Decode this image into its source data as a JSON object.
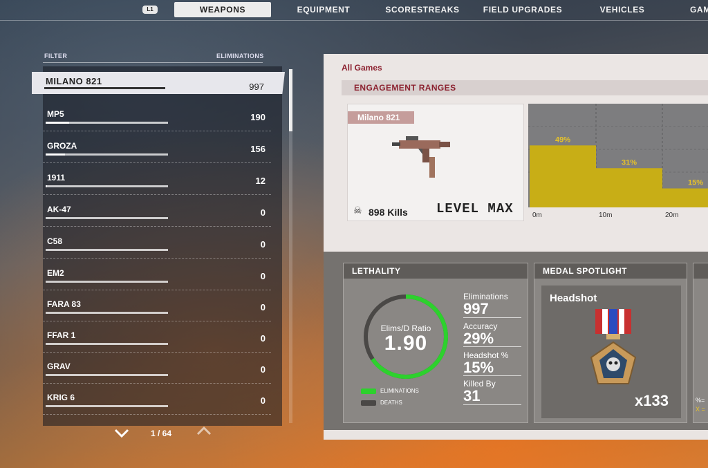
{
  "nav": {
    "l1_badge": "L1",
    "tabs": [
      {
        "label": "WEAPONS",
        "active": true
      },
      {
        "label": "EQUIPMENT",
        "active": false
      },
      {
        "label": "SCORESTREAKS",
        "active": false
      },
      {
        "label": "FIELD UPGRADES",
        "active": false
      },
      {
        "label": "VEHICLES",
        "active": false
      },
      {
        "label": "GAM",
        "active": false
      }
    ]
  },
  "list": {
    "filter_label": "FILTER",
    "elims_label": "ELIMINATIONS",
    "items": [
      {
        "name": "MILANO 821",
        "value": "997",
        "progress": 1.0,
        "selected": true
      },
      {
        "name": "MP5",
        "value": "190",
        "progress": 0.19
      },
      {
        "name": "GROZA",
        "value": "156",
        "progress": 0.16
      },
      {
        "name": "1911",
        "value": "12",
        "progress": 0.01
      },
      {
        "name": "AK-47",
        "value": "0",
        "progress": 0
      },
      {
        "name": "C58",
        "value": "0",
        "progress": 0
      },
      {
        "name": "EM2",
        "value": "0",
        "progress": 0
      },
      {
        "name": "FARA 83",
        "value": "0",
        "progress": 0
      },
      {
        "name": "FFAR 1",
        "value": "0",
        "progress": 0
      },
      {
        "name": "GRAV",
        "value": "0",
        "progress": 0
      },
      {
        "name": "KRIG 6",
        "value": "0",
        "progress": 0
      }
    ],
    "pagination": "1 / 64",
    "prev_icon": "chevron-down-icon",
    "next_icon": "chevron-up-icon"
  },
  "card": {
    "mode": "All Games",
    "section_title": "ENGAGEMENT RANGES",
    "weapon": {
      "name": "Milano 821",
      "kills": "898 Kills",
      "level": "LEVEL MAX"
    }
  },
  "chart_data": {
    "type": "bar",
    "categories": [
      "0m",
      "10m",
      "20m"
    ],
    "values": [
      49,
      31,
      15
    ],
    "labels": [
      "49%",
      "31%",
      "15%"
    ],
    "bar_color": "#c8ae16",
    "ylim": [
      0,
      100
    ]
  },
  "lethality": {
    "title": "LETHALITY",
    "ratio_label": "Elims/D Ratio",
    "ratio_value": "1.90",
    "ring_fraction": 0.655,
    "legend_elims": "ELIMINATIONS",
    "legend_deaths": "DEATHS",
    "stats": [
      {
        "label": "Eliminations",
        "value": "997"
      },
      {
        "label": "Accuracy",
        "value": "29%"
      },
      {
        "label": "Headshot %",
        "value": "15%"
      },
      {
        "label": "Killed By",
        "value": "31"
      }
    ],
    "colors": {
      "elims": "#2dd12d",
      "deaths": "#4a4846"
    }
  },
  "medal": {
    "title": "MEDAL SPOTLIGHT",
    "name": "Headshot",
    "count": "x133"
  },
  "side_panel": {
    "line1": "%=",
    "line2": "X ="
  }
}
